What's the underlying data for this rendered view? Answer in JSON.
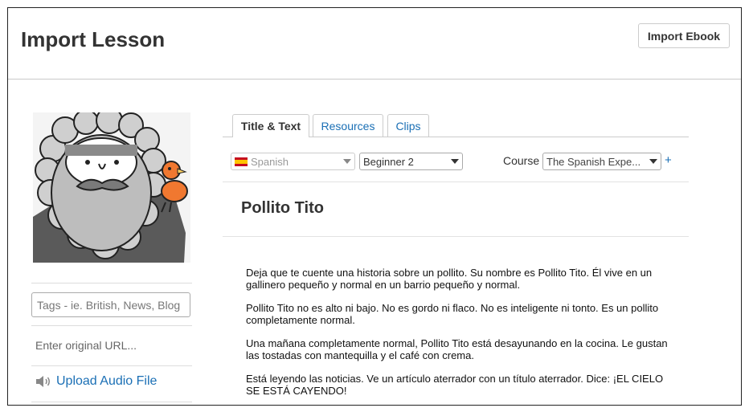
{
  "header": {
    "title": "Import Lesson",
    "import_ebook_label": "Import Ebook"
  },
  "sidebar": {
    "tags_placeholder": "Tags - ie. British, News, Blog",
    "url_placeholder": "Enter original URL...",
    "upload_label": "Upload Audio File",
    "upload_icon": "speaker-icon"
  },
  "tabs": [
    {
      "label": "Title & Text",
      "active": true
    },
    {
      "label": "Resources",
      "active": false
    },
    {
      "label": "Clips",
      "active": false
    }
  ],
  "selectors": {
    "language": "Spanish",
    "language_flag": "spain-flag-icon",
    "level": "Beginner 2",
    "course_label": "Course",
    "course": "The Spanish Expe...",
    "add_course": "+"
  },
  "lesson": {
    "title": "Pollito Tito",
    "paragraphs": [
      "Deja que te cuente una historia sobre un pollito. Su nombre es Pollito Tito. Él vive en un gallinero pequeño y normal en un barrio pequeño y normal.",
      "Pollito Tito no es alto ni bajo. No es gordo ni flaco. No es inteligente ni tonto. Es un pollito completamente normal.",
      "Una mañana completamente normal, Pollito Tito está desayunando en la cocina. Le gustan las tostadas con mantequilla y el café con crema.",
      "Está leyendo las noticias. Ve un artículo aterrador con un título aterrador. Dice: ¡EL CIELO SE ESTÁ CAYENDO!"
    ]
  },
  "colors": {
    "link": "#1a6fb5",
    "bird": "#f07830"
  }
}
